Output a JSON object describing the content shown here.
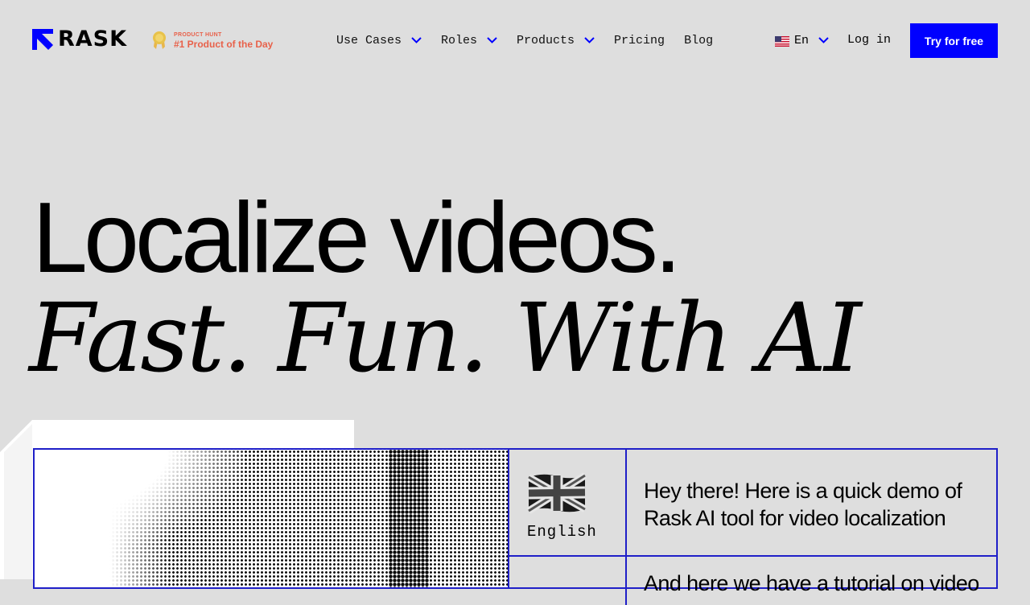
{
  "brand": {
    "name": "RASK",
    "accent": "#0000ff"
  },
  "badge": {
    "eyebrow": "PRODUCT HUNT",
    "title": "#1 Product of the Day",
    "color": "#e8614a"
  },
  "nav": {
    "items": [
      {
        "label": "Use Cases",
        "dropdown": true
      },
      {
        "label": "Roles",
        "dropdown": true
      },
      {
        "label": "Products",
        "dropdown": true
      },
      {
        "label": "Pricing",
        "dropdown": false
      },
      {
        "label": "Blog",
        "dropdown": false
      }
    ],
    "language": "En",
    "login": "Log in",
    "cta": "Try for free"
  },
  "hero": {
    "line1": "Localize videos.",
    "line2": "Fast. Fun. With AI"
  },
  "demo": {
    "language_label": "English",
    "transcript": "Hey there! Here is a quick demo of Rask AI tool for video localization",
    "next_line": "And here we have a tutorial on video"
  }
}
